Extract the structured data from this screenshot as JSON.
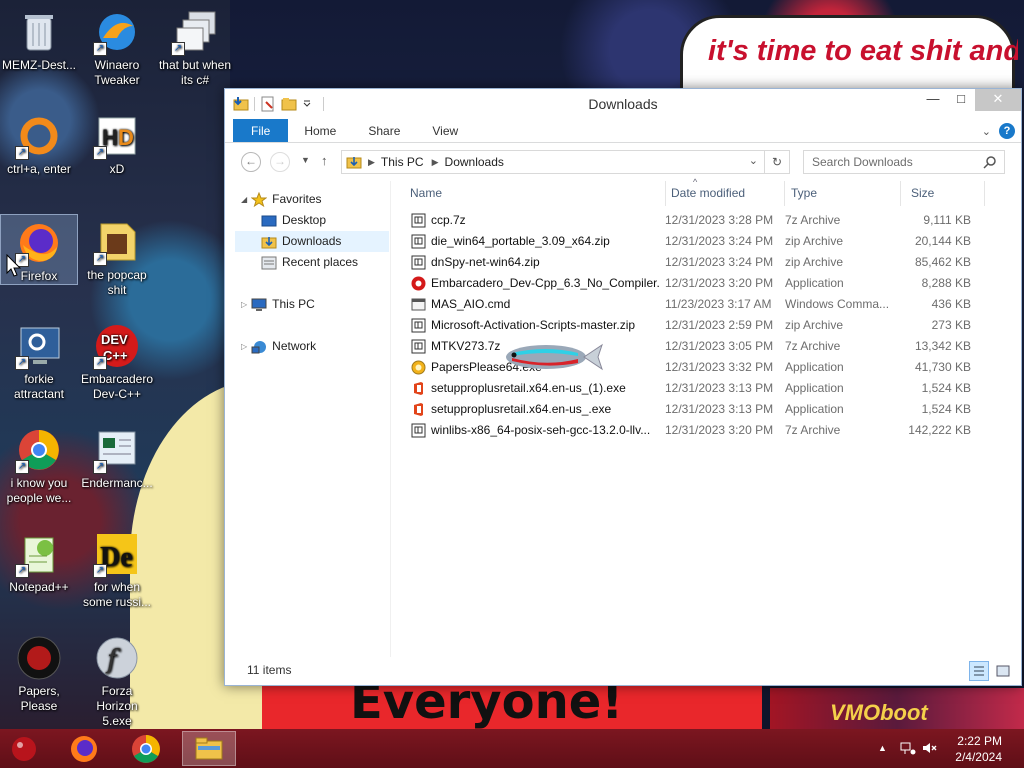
{
  "wallpaper": {
    "speech_text": "it's time to eat shit and die and celebrate",
    "banner_text": "Everyone!",
    "ad_text": "VMOboot"
  },
  "desktop_icons": [
    {
      "label": "MEMZ-Dest...",
      "icon": "recycle-bin-icon"
    },
    {
      "label": "Winaero Tweaker",
      "icon": "winaero-icon"
    },
    {
      "label": "that but when its c#",
      "icon": "windows-stack-icon"
    },
    {
      "label": "ctrl+a, enter",
      "icon": "ring-icon"
    },
    {
      "label": "xD",
      "icon": "hxd-icon"
    },
    {
      "label": "Firefox",
      "icon": "firefox-icon"
    },
    {
      "label": "the popcap shit",
      "icon": "popcap-icon"
    },
    {
      "label": "forkie attractant",
      "icon": "settings-monitor-icon"
    },
    {
      "label": "Embarcadero Dev-C++",
      "icon": "devcpp-icon"
    },
    {
      "label": "i know you people we...",
      "icon": "chrome-icon"
    },
    {
      "label": "Endermanc...",
      "icon": "enderman-icon"
    },
    {
      "label": "Notepad++",
      "icon": "notepadpp-icon"
    },
    {
      "label": "for when some russi...",
      "icon": "de-icon"
    },
    {
      "label": "Papers, Please",
      "icon": "papers-please-icon"
    },
    {
      "label": "Forza Horizon 5.exe",
      "icon": "flash-icon"
    }
  ],
  "window": {
    "title": "Downloads",
    "ribbon_tabs": [
      "File",
      "Home",
      "Share",
      "View"
    ],
    "address": {
      "root": "This PC",
      "current": "Downloads"
    },
    "search_placeholder": "Search Downloads",
    "nav": {
      "favorites": "Favorites",
      "desktop": "Desktop",
      "downloads": "Downloads",
      "recent": "Recent places",
      "thispc": "This PC",
      "network": "Network"
    },
    "columns": {
      "name": "Name",
      "date": "Date modified",
      "type": "Type",
      "size": "Size"
    },
    "files": [
      {
        "name": "ccp.7z",
        "date": "12/31/2023 3:28 PM",
        "type": "7z Archive",
        "size": "9,111 KB",
        "icon": "archive-icon"
      },
      {
        "name": "die_win64_portable_3.09_x64.zip",
        "date": "12/31/2023 3:24 PM",
        "type": "zip Archive",
        "size": "20,144 KB",
        "icon": "archive-icon"
      },
      {
        "name": "dnSpy-net-win64.zip",
        "date": "12/31/2023 3:24 PM",
        "type": "zip Archive",
        "size": "85,462 KB",
        "icon": "archive-icon"
      },
      {
        "name": "Embarcadero_Dev-Cpp_6.3_No_Compiler...",
        "date": "12/31/2023 3:20 PM",
        "type": "Application",
        "size": "8,288 KB",
        "icon": "devcpp-small-icon"
      },
      {
        "name": "MAS_AIO.cmd",
        "date": "11/23/2023 3:17 AM",
        "type": "Windows Comma...",
        "size": "436 KB",
        "icon": "cmd-icon"
      },
      {
        "name": "Microsoft-Activation-Scripts-master.zip",
        "date": "12/31/2023 2:59 PM",
        "type": "zip Archive",
        "size": "273 KB",
        "icon": "archive-icon"
      },
      {
        "name": "MTKV273.7z",
        "date": "12/31/2023 3:05 PM",
        "type": "7z Archive",
        "size": "13,342 KB",
        "icon": "archive-icon"
      },
      {
        "name": "PapersPlease64.exe",
        "date": "12/31/2023 3:32 PM",
        "type": "Application",
        "size": "41,730 KB",
        "icon": "app-icon"
      },
      {
        "name": "setupproplusretail.x64.en-us_(1).exe",
        "date": "12/31/2023 3:13 PM",
        "type": "Application",
        "size": "1,524 KB",
        "icon": "office-icon"
      },
      {
        "name": "setupproplusretail.x64.en-us_.exe",
        "date": "12/31/2023 3:13 PM",
        "type": "Application",
        "size": "1,524 KB",
        "icon": "office-icon"
      },
      {
        "name": "winlibs-x86_64-posix-seh-gcc-13.2.0-llv...",
        "date": "12/31/2023 3:20 PM",
        "type": "7z Archive",
        "size": "142,222 KB",
        "icon": "archive-icon"
      }
    ],
    "status": "11 items"
  },
  "taskbar": {
    "time": "2:22 PM",
    "date": "2/4/2024"
  },
  "colors": {
    "accent": "#1979ca",
    "taskbar": "#6e131b"
  }
}
